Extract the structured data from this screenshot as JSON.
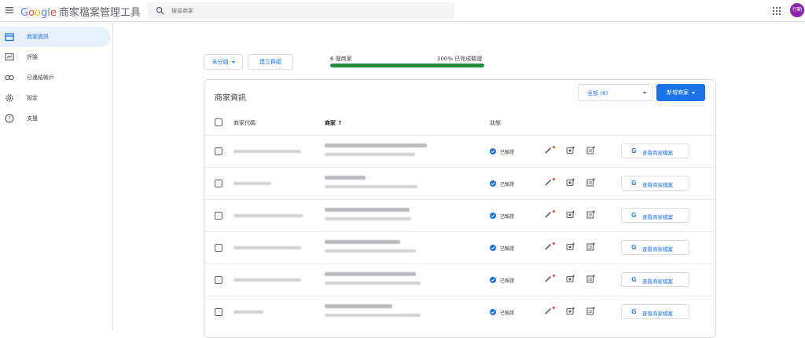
{
  "header": {
    "logo_google": [
      "G",
      "o",
      "o",
      "g",
      "l",
      "e"
    ],
    "product_name": "商家檔案管理工具",
    "search_placeholder": "搜尋商家",
    "avatar_label": "行動"
  },
  "sidebar": {
    "items": [
      {
        "label": "商家資訊",
        "icon": "storefront-icon",
        "active": true
      },
      {
        "label": "評論",
        "icon": "reviews-icon",
        "active": false
      },
      {
        "label": "已連結帳戶",
        "icon": "link-icon",
        "active": false
      },
      {
        "label": "設定",
        "icon": "gear-icon",
        "active": false
      },
      {
        "label": "支援",
        "icon": "help-icon",
        "active": false
      }
    ]
  },
  "toolbar": {
    "group_select": "未分組",
    "create_group": "建立群組"
  },
  "summary": {
    "left": "6 個商家",
    "right": "100% 已完成驗證",
    "progress_fraction": 1.0
  },
  "card": {
    "title": "商家資訊",
    "filter_label": "全部 (6)",
    "add_button": "新增商家",
    "columns": {
      "code": "商家代碼",
      "business": "商家",
      "status": "狀態"
    },
    "sort_arrow": "↑",
    "rows": [
      {
        "status": "已驗證",
        "view_label": "查看商家檔案"
      },
      {
        "status": "已驗證",
        "view_label": "查看商家檔案"
      },
      {
        "status": "已驗證",
        "view_label": "查看商家檔案"
      },
      {
        "status": "已驗證",
        "view_label": "查看商家檔案"
      },
      {
        "status": "已驗證",
        "view_label": "查看商家檔案"
      },
      {
        "status": "已驗證",
        "view_label": "查看商家檔案"
      }
    ]
  },
  "colors": {
    "accent": "#1a73e8",
    "progress": "#1e8e3e",
    "avatar": "#8e24aa",
    "active_nav_bg": "#e8f0fe"
  }
}
